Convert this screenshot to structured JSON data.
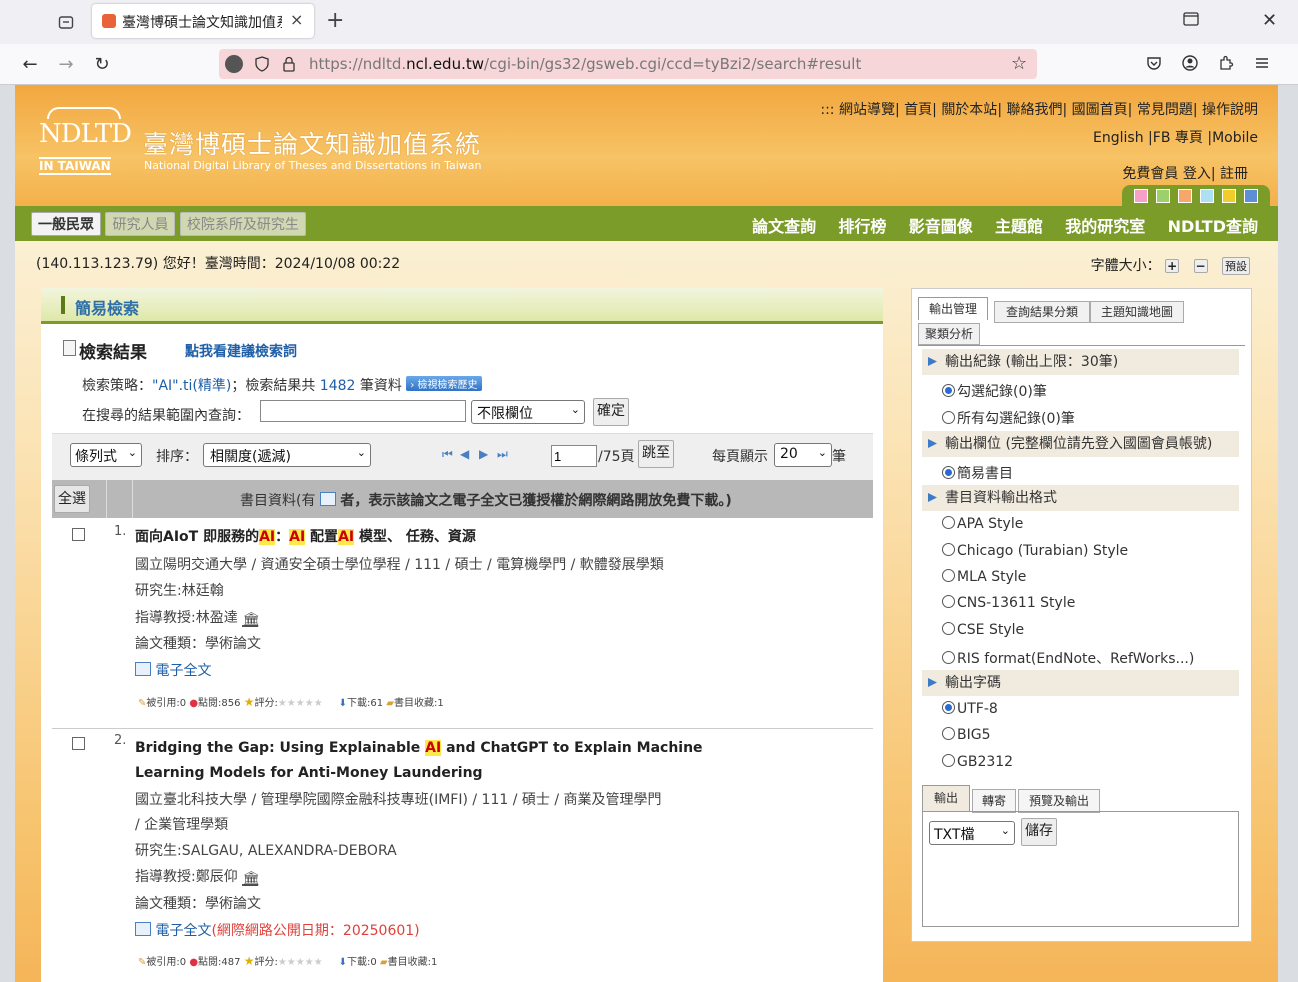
{
  "browser": {
    "tab_title": "臺灣博碩士論文知識加值系統",
    "url_prefix": "https://ndltd.",
    "url_domain": "ncl.edu.tw",
    "url_path": "/cgi-bin/gs32/gsweb.cgi/ccd=tyBzi2/search#result"
  },
  "header": {
    "logo_text": "NDLTD",
    "logo_sub": "IN TAIWAN",
    "title_zh": "臺灣博碩士論文知識加值系統",
    "title_en": "National Digital Library of Theses and Dissertations in Taiwan",
    "top_links": [
      ":::",
      "網站導覽",
      "首頁",
      "關於本站",
      "聯絡我們",
      "國圖首頁",
      "常見問題",
      "操作說明"
    ],
    "lang_links": [
      "English",
      "FB 專頁",
      "Mobile"
    ],
    "account_links": [
      "免費會員",
      "登入",
      "註冊"
    ],
    "theme_colors": [
      "#f6a0c8",
      "#9bd06b",
      "#f7a76c",
      "#aee0f4",
      "#f2cc2a",
      "#5c8fd6"
    ]
  },
  "nav": {
    "user_tabs": [
      "一般民眾",
      "研究人員",
      "校院系所及研究生"
    ],
    "main_links": [
      "論文查詢",
      "排行榜",
      "影音圖像",
      "主題館",
      "我的研究室",
      "NDLTD查詢"
    ]
  },
  "status": {
    "greeting": "(140.113.123.79) 您好！臺灣時間：2024/10/08 00:22",
    "font_size_label": "字體大小：",
    "font_plus": "+",
    "font_minus": "−",
    "font_default": "預設"
  },
  "search": {
    "section_title": "簡易檢索",
    "results_title": "檢索結果",
    "suggest_link": "點我看建議檢索詞",
    "strategy_label": "檢索策略：",
    "strategy_value": "\"AI\".ti(精準)",
    "count_prefix": "；檢索結果共",
    "count": "1482",
    "count_suffix": "筆資料",
    "history_btn": "檢視檢索歷史",
    "within_label": "在搜尋的結果範圍內查詢：",
    "within_value": "",
    "field_select": "不限欄位",
    "confirm_btn": "確定"
  },
  "controls": {
    "view_select": "條列式",
    "sort_label": "排序：",
    "sort_select": "相關度(遞減)",
    "page_value": "1",
    "page_total": "/75頁",
    "goto_btn": "跳至",
    "per_page_label": "每頁顯示",
    "per_page_value": "20",
    "per_page_unit": "筆"
  },
  "table": {
    "select_all": "全選",
    "header_prefix": "書目資料(有",
    "header_suffix": "者，表示該論文之電子全文已獲授權於網際網路開放免費下載。)"
  },
  "results": [
    {
      "num": "1.",
      "title_a": "面向AIoT 即服務的",
      "title_hl1": "AI",
      "title_b": "：",
      "title_hl2": "AI",
      "title_c": " 配置",
      "title_hl3": "AI",
      "title_d": " 模型、 任務、資源",
      "affil": "國立陽明交通大學 / 資通安全碩士學位學程 / 111 / 碩士 / 電算機學門 / 軟體發展學類",
      "student": "研究生:林廷翰",
      "advisor": "指導教授:林盈達",
      "type": "論文種類：學術論文",
      "fulltext": "電子全文",
      "fulltext_date": "",
      "cited": "被引用:0",
      "clicks": "點閱:856",
      "rating": "評分:",
      "downloads": "下載:61",
      "saved": "書目收藏:1"
    },
    {
      "num": "2.",
      "title_a": "Bridging the Gap: Using Explainable ",
      "title_hl1": "AI",
      "title_b": " and ChatGPT to Explain Machine",
      "title_line2": "Learning Models for Anti-Money Laundering",
      "affil": "國立臺北科技大學 / 管理學院國際金融科技專班(IMFI) / 111 / 碩士 / 商業及管理學門",
      "affil2": "/ 企業管理學類",
      "student": "研究生:SALGAU, ALEXANDRA-DEBORA",
      "advisor": "指導教授:鄭辰仰",
      "type": "論文種類：學術論文",
      "fulltext": "電子全文",
      "fulltext_date": "(網際網路公開日期：20250601)",
      "cited": "被引用:0",
      "clicks": "點閱:487",
      "rating": "評分:",
      "downloads": "下載:0",
      "saved": "書目收藏:1"
    }
  ],
  "sidebar": {
    "tabs": [
      "輸出管理",
      "查詢結果分類",
      "主題知識地圖",
      "聚類分析"
    ],
    "sec_records": "輸出紀錄 (輸出上限：30筆)",
    "rec_opt1": "勾選紀錄(0)筆",
    "rec_opt2": "所有勾選紀錄(0)筆",
    "sec_fields": "輸出欄位 (完整欄位請先登入國圖會員帳號)",
    "field_opt1": "簡易書目",
    "sec_format": "書目資料輸出格式",
    "formats": [
      "APA Style",
      "Chicago (Turabian) Style",
      "MLA Style",
      "CNS-13611 Style",
      "CSE Style",
      "RIS format(EndNote、RefWorks...)"
    ],
    "sec_encoding": "輸出字碼",
    "encodings": [
      "UTF-8",
      "BIG5",
      "GB2312"
    ],
    "out_tabs": [
      "輸出",
      "轉寄",
      "預覽及輸出"
    ],
    "out_select": "TXT檔",
    "save_btn": "儲存"
  }
}
